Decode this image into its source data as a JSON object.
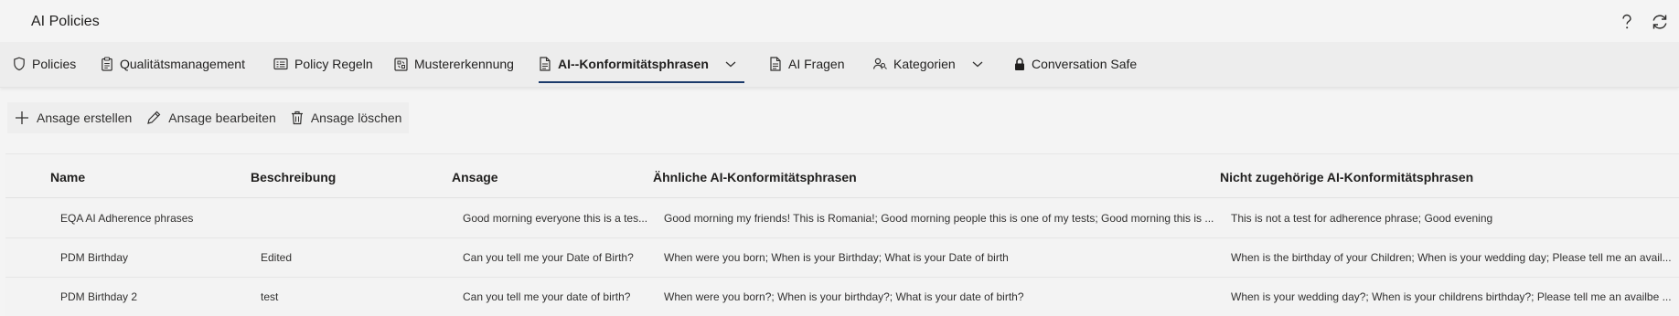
{
  "app": {
    "title": "AI Policies"
  },
  "title_icons": {
    "help": "help-icon",
    "refresh": "refresh-icon"
  },
  "tabs": [
    {
      "label": "Policies",
      "icon": "shield-icon"
    },
    {
      "label": "Qualitätsmanagement",
      "icon": "clipboard-icon"
    },
    {
      "label": "Policy Regeln",
      "icon": "list-card-icon"
    },
    {
      "label": "Mustererkennung",
      "icon": "pattern-icon"
    },
    {
      "label": "AI--Konformitätsphrasen",
      "icon": "document-icon",
      "active": true,
      "dropdown": true
    },
    {
      "label": "AI Fragen",
      "icon": "document-icon"
    },
    {
      "label": "Kategorien",
      "icon": "people-icon",
      "dropdown": true
    },
    {
      "label": "Conversation Safe",
      "icon": "lock-icon"
    }
  ],
  "commands": {
    "create": "Ansage erstellen",
    "edit": "Ansage bearbeiten",
    "delete": "Ansage löschen"
  },
  "table": {
    "columns": [
      "Name",
      "Beschreibung",
      "Ansage",
      "Ähnliche AI-Konformitätsphrasen",
      "Nicht zugehörige AI-Konformitätsphrasen"
    ],
    "rows": [
      [
        "EQA AI Adherence phrases",
        "",
        "Good morning everyone this is a tes...",
        "Good morning my friends! This is Romania!; Good morning people this is one of my tests; Good morning this is ...",
        "This is not a test for adherence phrase; Good evening"
      ],
      [
        "PDM Birthday",
        "Edited",
        "Can you tell me your Date of Birth?",
        "When were you born; When is your Birthday; What is your Date of birth",
        "When is the birthday of your Children; When is your wedding day; Please tell me an avail..."
      ],
      [
        "PDM Birthday 2",
        "test",
        "Can you tell me your date of birth?",
        "When were you born?; When is your birthday?; What is your date of birth?",
        "When is your wedding day?; When is your childrens birthday?; Please tell me an availbe ..."
      ]
    ]
  },
  "colors": {
    "accent": "#1b3a6b",
    "background": "#f4f4f4",
    "tabbar": "#ededed"
  }
}
